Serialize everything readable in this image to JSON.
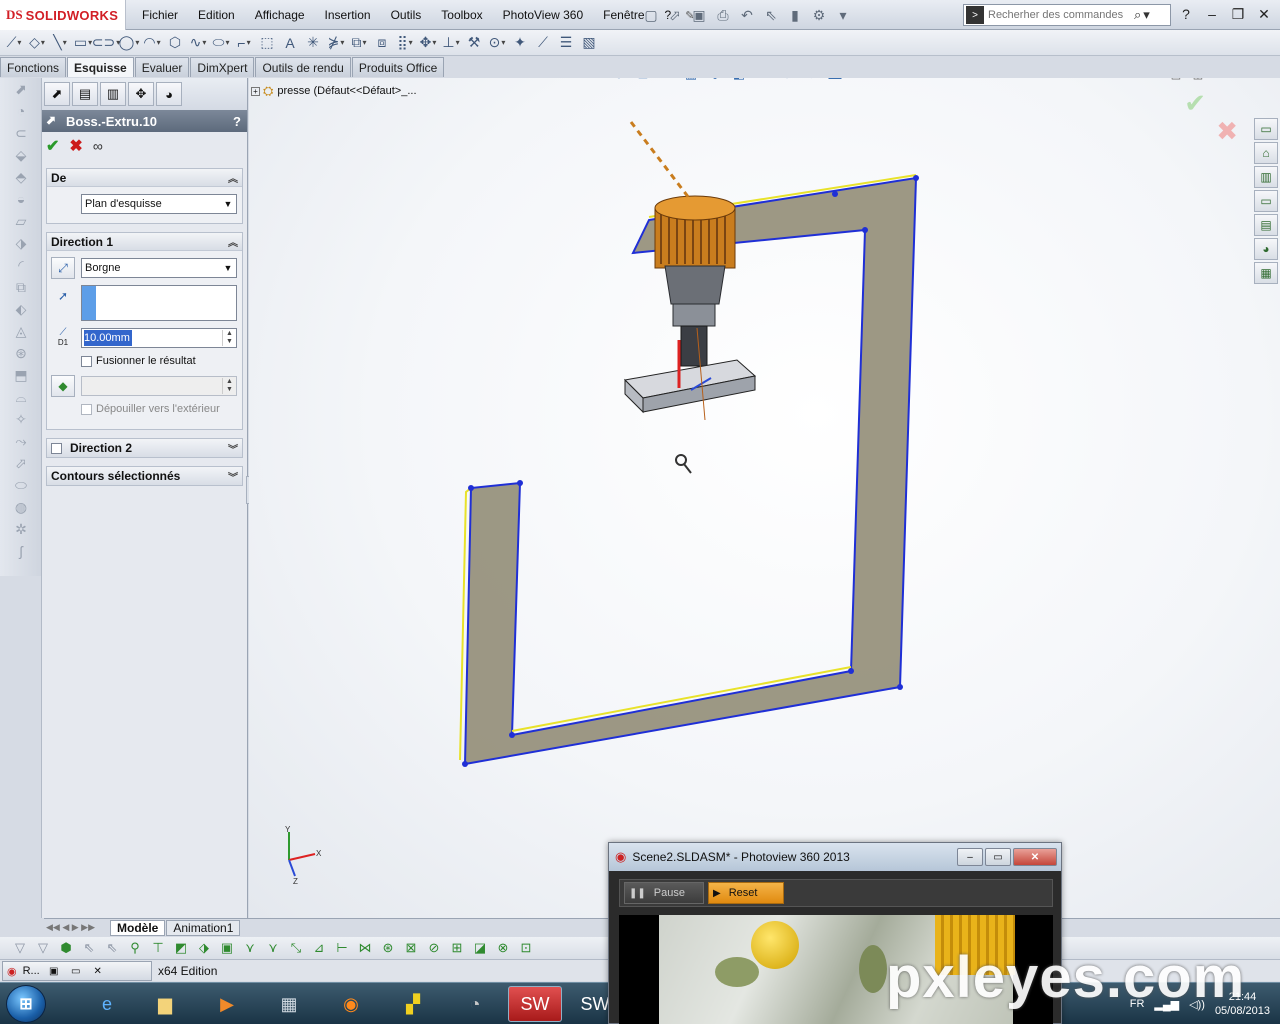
{
  "app": {
    "logo_prefix": "DS",
    "logo_text": "SOLIDWORKS",
    "brand_color": "#d21f26"
  },
  "menu": {
    "items": [
      "Fichier",
      "Edition",
      "Affichage",
      "Insertion",
      "Outils",
      "Toolbox",
      "PhotoView 360",
      "Fenêtre",
      "?"
    ]
  },
  "search": {
    "placeholder": "Recherher des commandes",
    "help": "?"
  },
  "tabs": {
    "items": [
      "Fonctions",
      "Esquisse",
      "Evaluer",
      "DimXpert",
      "Outils de rendu",
      "Produits Office"
    ],
    "active_index": 1
  },
  "property_manager": {
    "title": "Boss.-Extru.10",
    "help": "?",
    "groups": {
      "from": {
        "title": "De",
        "value": "Plan d'esquisse"
      },
      "direction1": {
        "title": "Direction 1",
        "end_condition": "Borgne",
        "depth_label": "D1",
        "depth": "10.00mm",
        "merge_label": "Fusionner le résultat",
        "draft_label": "Dépouiller vers l'extérieur"
      },
      "direction2": {
        "title": "Direction 2"
      },
      "contours": {
        "title": "Contours sélectionnés"
      }
    }
  },
  "feature_tree": {
    "label": "presse  (Défaut<<Défaut>_..."
  },
  "triad": {
    "x": "X",
    "y": "Y",
    "z": "Z"
  },
  "model_tabs": {
    "items": [
      "Modèle",
      "Animation1"
    ],
    "active_index": 0
  },
  "status": {
    "min_window_label": "R...",
    "edition": "x64 Edition"
  },
  "photoview": {
    "title": "Scene2.SLDASM* - Photoview 360 2013",
    "pause": "Pause",
    "reset": "Reset",
    "accent": "#f0a22a"
  },
  "tray": {
    "lang": "FR",
    "time": "21:44",
    "date": "05/08/2013"
  },
  "watermark": "pxleyes.com"
}
